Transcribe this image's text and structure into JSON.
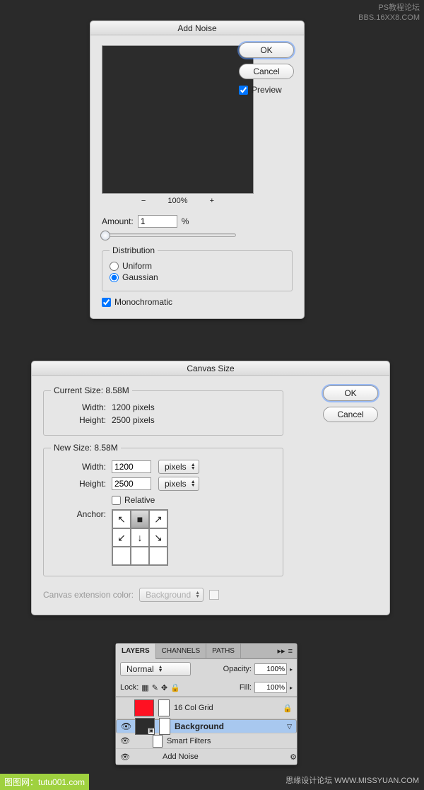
{
  "watermark": {
    "top1": "PS教程论坛",
    "top2": "BBS.16XX8.COM",
    "br": "思缘设计论坛   WWW.MISSYUAN.COM",
    "bl": "图图网：tutu001.com"
  },
  "addNoise": {
    "title": "Add Noise",
    "ok": "OK",
    "cancel": "Cancel",
    "preview": "Preview",
    "zoom": "100%",
    "amountLabel": "Amount:",
    "amountValue": "1",
    "percent": "%",
    "distribution": "Distribution",
    "uniform": "Uniform",
    "gaussian": "Gaussian",
    "monochromatic": "Monochromatic"
  },
  "canvasSize": {
    "title": "Canvas Size",
    "ok": "OK",
    "cancel": "Cancel",
    "currentSize": "Current Size: 8.58M",
    "widthLabel": "Width:",
    "heightLabel": "Height:",
    "curWidth": "1200 pixels",
    "curHeight": "2500 pixels",
    "newSize": "New Size: 8.58M",
    "newWidth": "1200",
    "newHeight": "2500",
    "unit": "pixels",
    "relative": "Relative",
    "anchor": "Anchor:",
    "extLabel": "Canvas extension color:",
    "extValue": "Background"
  },
  "layers": {
    "tabs": {
      "layers": "LAYERS",
      "channels": "CHANNELS",
      "paths": "PATHS"
    },
    "blend": "Normal",
    "opacityLabel": "Opacity:",
    "opacity": "100%",
    "lockLabel": "Lock:",
    "fillLabel": "Fill:",
    "fill": "100%",
    "layer1": "16 Col Grid",
    "layer2": "Background",
    "smartFilters": "Smart Filters",
    "addNoise": "Add Noise"
  }
}
